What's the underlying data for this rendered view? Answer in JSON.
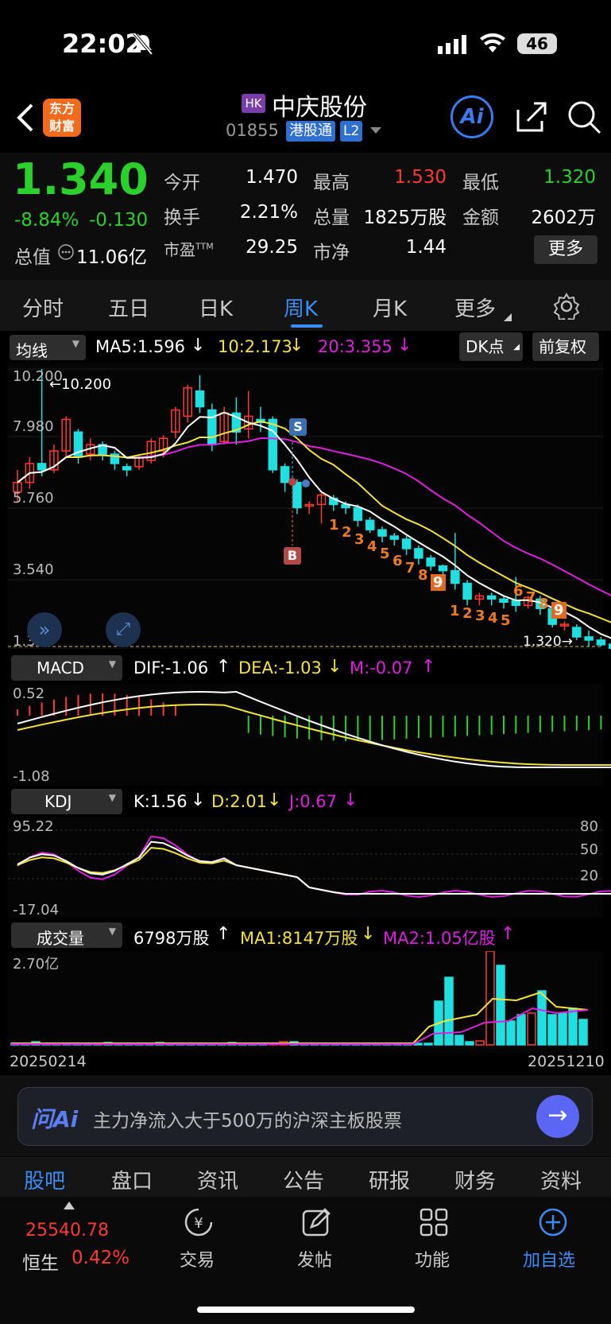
{
  "status": {
    "time": "22:02",
    "battery": "46"
  },
  "header": {
    "logo_line1": "东方",
    "logo_line2": "财富",
    "market_badge": "HK",
    "stock_name": "中庆股份",
    "code": "01855",
    "connect_badge": "港股通",
    "level_badge": "L2",
    "ai_label": "Ai"
  },
  "quote": {
    "price": "1.340",
    "pct": "-8.84%",
    "chg": "-0.130",
    "open_label": "今开",
    "open": "1.470",
    "high_label": "最高",
    "high": "1.530",
    "low_label": "最低",
    "low": "1.320",
    "turnover_label": "换手",
    "turnover": "2.21%",
    "volume_label": "总量",
    "volume": "1825万股",
    "amount_label": "金额",
    "amount": "2602万",
    "mktcap_label": "总值",
    "mktcap": "11.06亿",
    "pe_label": "市盈",
    "pe_sup": "TTM",
    "pe": "29.25",
    "pb_label": "市净",
    "pb": "1.44",
    "more_button": "更多"
  },
  "tabs": [
    "分时",
    "五日",
    "日K",
    "周K",
    "月K",
    "更多"
  ],
  "active_tab": "周K",
  "ma_bar": {
    "selector": "均线",
    "ma5": "MA5:1.596",
    "ma10": "10:2.173",
    "ma20": "20:3.355",
    "dk_button": "DK点",
    "fq_button": "前复权"
  },
  "kline": {
    "y_labels": [
      "10.200",
      "7.980",
      "5.760",
      "3.540",
      "1.320"
    ],
    "max_marker": "10.200",
    "min_marker": "1.320",
    "buy_marker": "B",
    "sell_marker": "S",
    "nine_seq_a": [
      "1",
      "2",
      "3",
      "4",
      "5",
      "6",
      "7",
      "8",
      "9"
    ],
    "nine_seq_b": [
      "1",
      "2",
      "3",
      "4",
      "5"
    ],
    "nine_seq_c": [
      "6",
      "7",
      "8",
      "9"
    ]
  },
  "macd": {
    "selector": "MACD",
    "dif": "DIF:-1.06",
    "dea": "DEA:-1.03",
    "m": "M:-0.07",
    "y_top": "0.52",
    "y_bottom": "-1.08"
  },
  "kdj": {
    "selector": "KDJ",
    "k": "K:1.56",
    "d": "D:2.01",
    "j": "J:0.67",
    "y_top": "95.22",
    "y_bottom": "-17.04",
    "levels": [
      "80",
      "50",
      "20"
    ]
  },
  "vol": {
    "selector": "成交量",
    "v": "6798万股",
    "ma1": "MA1:8147万股",
    "ma2": "MA2:1.05亿股",
    "y_top": "2.70亿",
    "date_start": "20250214",
    "date_end": "20251210"
  },
  "ask": {
    "brand": "问Ai",
    "prompt": "主力净流入大于500万的沪深主板股票"
  },
  "bottom_tabs": [
    "股吧",
    "盘口",
    "资讯",
    "公告",
    "研报",
    "财务",
    "资料"
  ],
  "dock": {
    "index_value": "25540.78",
    "index_name": "恒生",
    "index_pct": "0.42%",
    "items": [
      "交易",
      "发帖",
      "功能",
      "加自选"
    ]
  },
  "colors": {
    "up": "#ff3b30",
    "down": "#1fe0e0",
    "green": "#2bd12b",
    "yellow": "#f5e23c",
    "magenta": "#e020e0",
    "accent": "#2f7ef5"
  }
}
